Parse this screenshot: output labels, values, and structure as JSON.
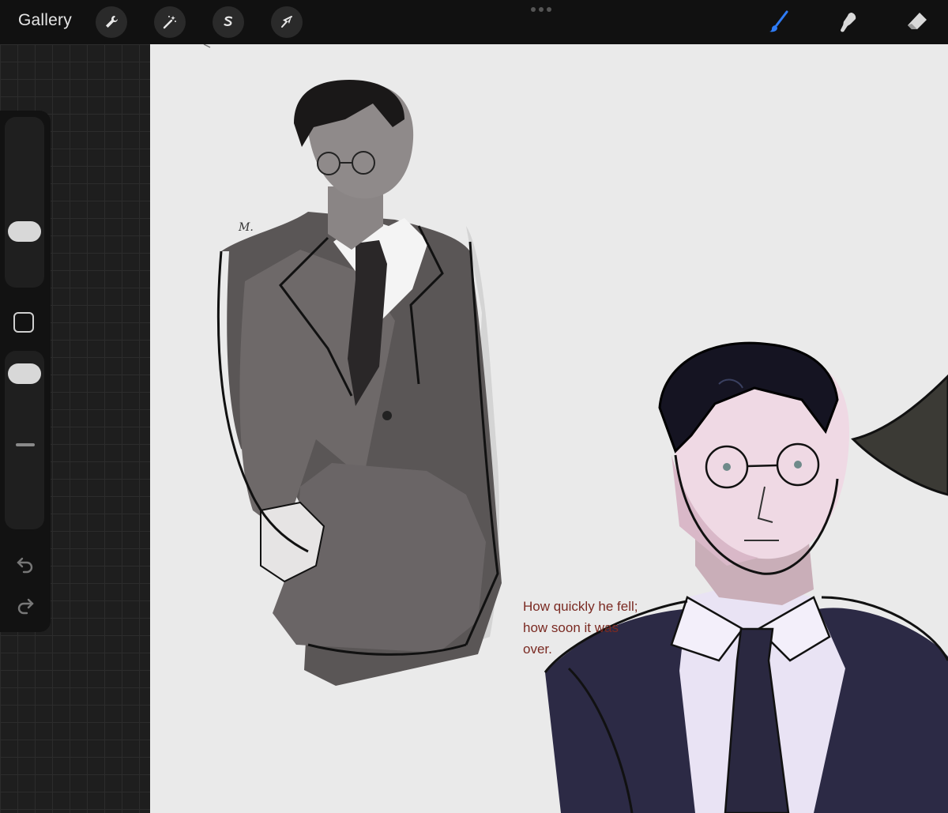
{
  "topbar": {
    "gallery_label": "Gallery",
    "tools_left": [
      "wrench-icon",
      "magic-wand-icon",
      "selection-icon",
      "transform-arrow-icon"
    ],
    "tools_right": [
      "brush-icon",
      "smudge-icon",
      "eraser-icon"
    ],
    "active_tool": "brush-icon",
    "accent_color": "#2f7cf6"
  },
  "canvas": {
    "caption_lines": [
      "How quickly he fell;",
      "how soon it was",
      "over."
    ],
    "signature": "M."
  }
}
